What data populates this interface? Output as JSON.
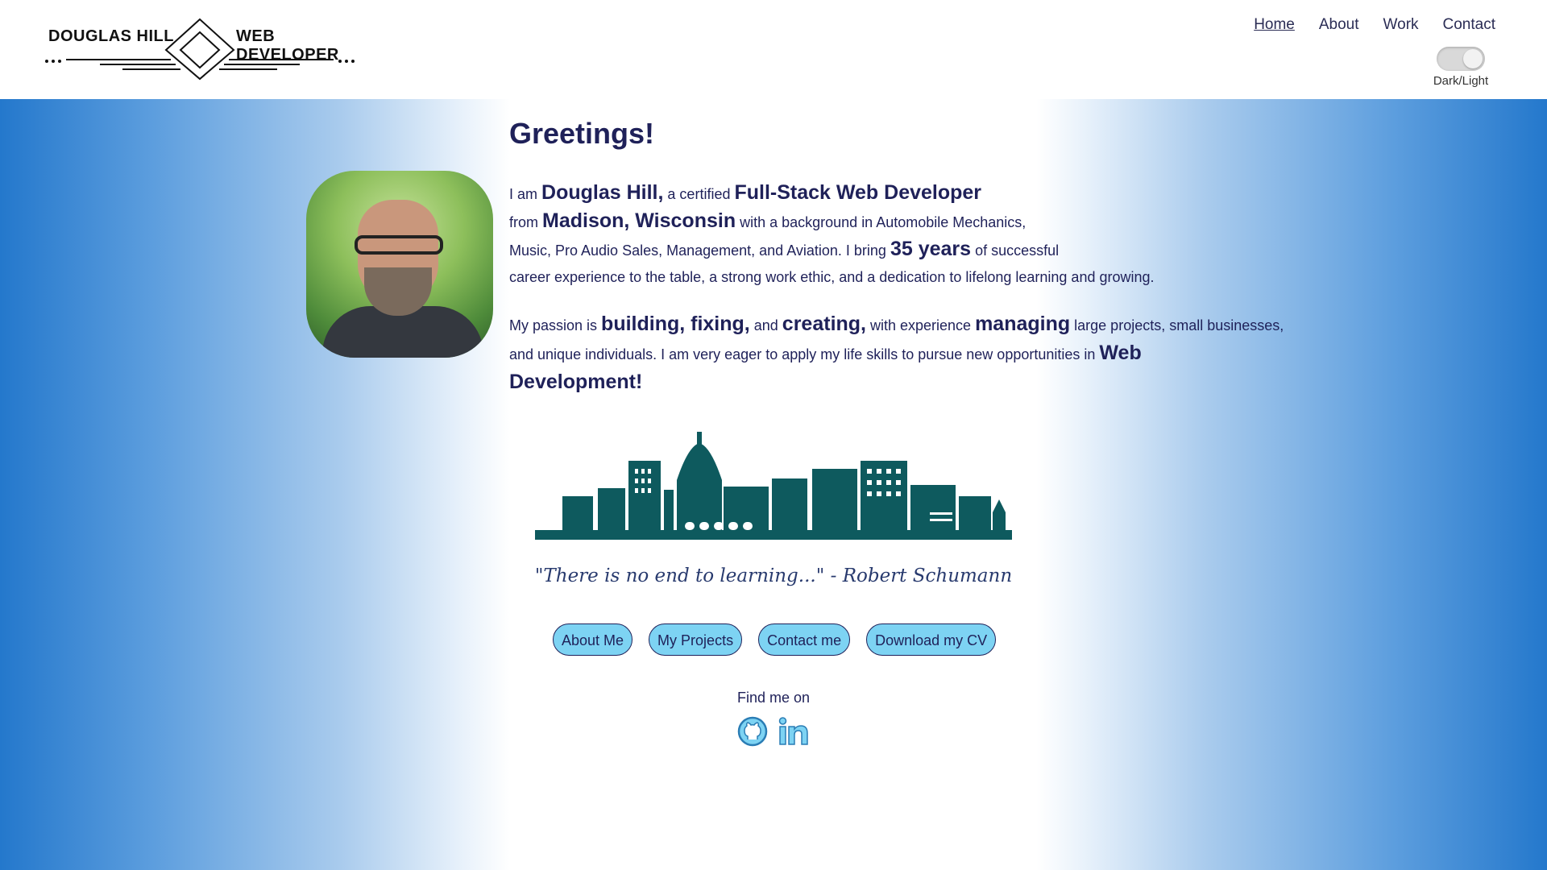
{
  "header": {
    "logo_left": "DOUGLAS HILL",
    "logo_right": "WEB DEVELOPER",
    "nav": [
      {
        "label": "Home",
        "active": true
      },
      {
        "label": "About",
        "active": false
      },
      {
        "label": "Work",
        "active": false
      },
      {
        "label": "Contact",
        "active": false
      }
    ],
    "theme_toggle_label": "Dark/Light"
  },
  "main": {
    "heading": "Greetings!",
    "intro": {
      "l1": [
        "I am ",
        "Douglas Hill,",
        " a certified ",
        "Full-Stack Web Developer"
      ],
      "l2": [
        "from ",
        "Madison, Wisconsin",
        " with a background in Automobile Mechanics,"
      ],
      "l3": [
        "Music, Pro Audio Sales, Management, and Aviation. I bring ",
        "35 years",
        " of successful"
      ],
      "l4": "career experience to the table, a strong work ethic, and a dedication to lifelong learning and growing."
    },
    "passion": {
      "l1": [
        "My passion is ",
        "building, fixing,",
        " and ",
        "creating,",
        " with experience ",
        "managing",
        " large projects, small businesses,"
      ],
      "l2": [
        "and unique individuals. I am very eager to apply my life skills to pursue new opportunities in ",
        "Web"
      ],
      "l3": "Development!"
    },
    "quote": "\"There is no end to learning...\" - Robert Schumann",
    "buttons": {
      "about": "About Me",
      "projects": "My Projects",
      "contact": "Contact me",
      "cv": "Download my CV"
    },
    "find_me": "Find me on",
    "social_icons": [
      "github-icon",
      "linkedin-icon"
    ]
  },
  "colors": {
    "text": "#1f2159",
    "button_bg": "#7dd3f3",
    "gradient_edge": "#2478cc",
    "skyline": "#0e5a5e"
  }
}
